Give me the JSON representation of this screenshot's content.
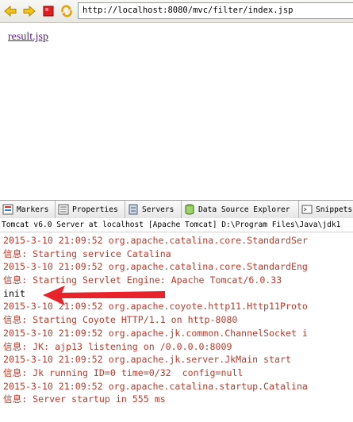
{
  "browser": {
    "url": "http://localhost:8080/mvc/filter/index.jsp",
    "icons": [
      "back-arrow",
      "forward-arrow",
      "stop",
      "refresh"
    ]
  },
  "page": {
    "link_text": "result.jsp"
  },
  "console_view": {
    "tabs": [
      {
        "label": "Markers",
        "icon": "markers-icon"
      },
      {
        "label": "Properties",
        "icon": "properties-icon"
      },
      {
        "label": "Servers",
        "icon": "servers-icon"
      },
      {
        "label": "Data Source Explorer",
        "icon": "data-source-icon"
      },
      {
        "label": "Snippets",
        "icon": "snippets-icon"
      }
    ],
    "title": "Tomcat v6.0 Server at localhost [Apache Tomcat] D:\\Program Files\\Java\\jdk1",
    "lines": [
      {
        "text": "2015-3-10 21:09:52 org.apache.catalina.core.StandardSer",
        "stream": "stderr"
      },
      {
        "text": "信息: Starting service Catalina",
        "stream": "stderr"
      },
      {
        "text": "2015-3-10 21:09:52 org.apache.catalina.core.StandardEng",
        "stream": "stderr"
      },
      {
        "text": "信息: Starting Servlet Engine: Apache Tomcat/6.0.33",
        "stream": "stderr"
      },
      {
        "text": "init",
        "stream": "stdout"
      },
      {
        "text": "2015-3-10 21:09:52 org.apache.coyote.http11.Http11Proto",
        "stream": "stderr"
      },
      {
        "text": "信息: Starting Coyote HTTP/1.1 on http-8080",
        "stream": "stderr"
      },
      {
        "text": "2015-3-10 21:09:52 org.apache.jk.common.ChannelSocket i",
        "stream": "stderr"
      },
      {
        "text": "信息: JK: ajp13 listening on /0.0.0.0:8009",
        "stream": "stderr"
      },
      {
        "text": "2015-3-10 21:09:52 org.apache.jk.server.JkMain start",
        "stream": "stderr"
      },
      {
        "text": "信息: Jk running ID=0 time=0/32  config=null",
        "stream": "stderr"
      },
      {
        "text": "2015-3-10 21:09:52 org.apache.catalina.startup.Catalina",
        "stream": "stderr"
      },
      {
        "text": "信息: Server startup in 555 ms",
        "stream": "stderr"
      }
    ],
    "colors": {
      "stderr": "#c0392b",
      "stdout": "#000000",
      "annotation_arrow": "#e8242a"
    }
  }
}
